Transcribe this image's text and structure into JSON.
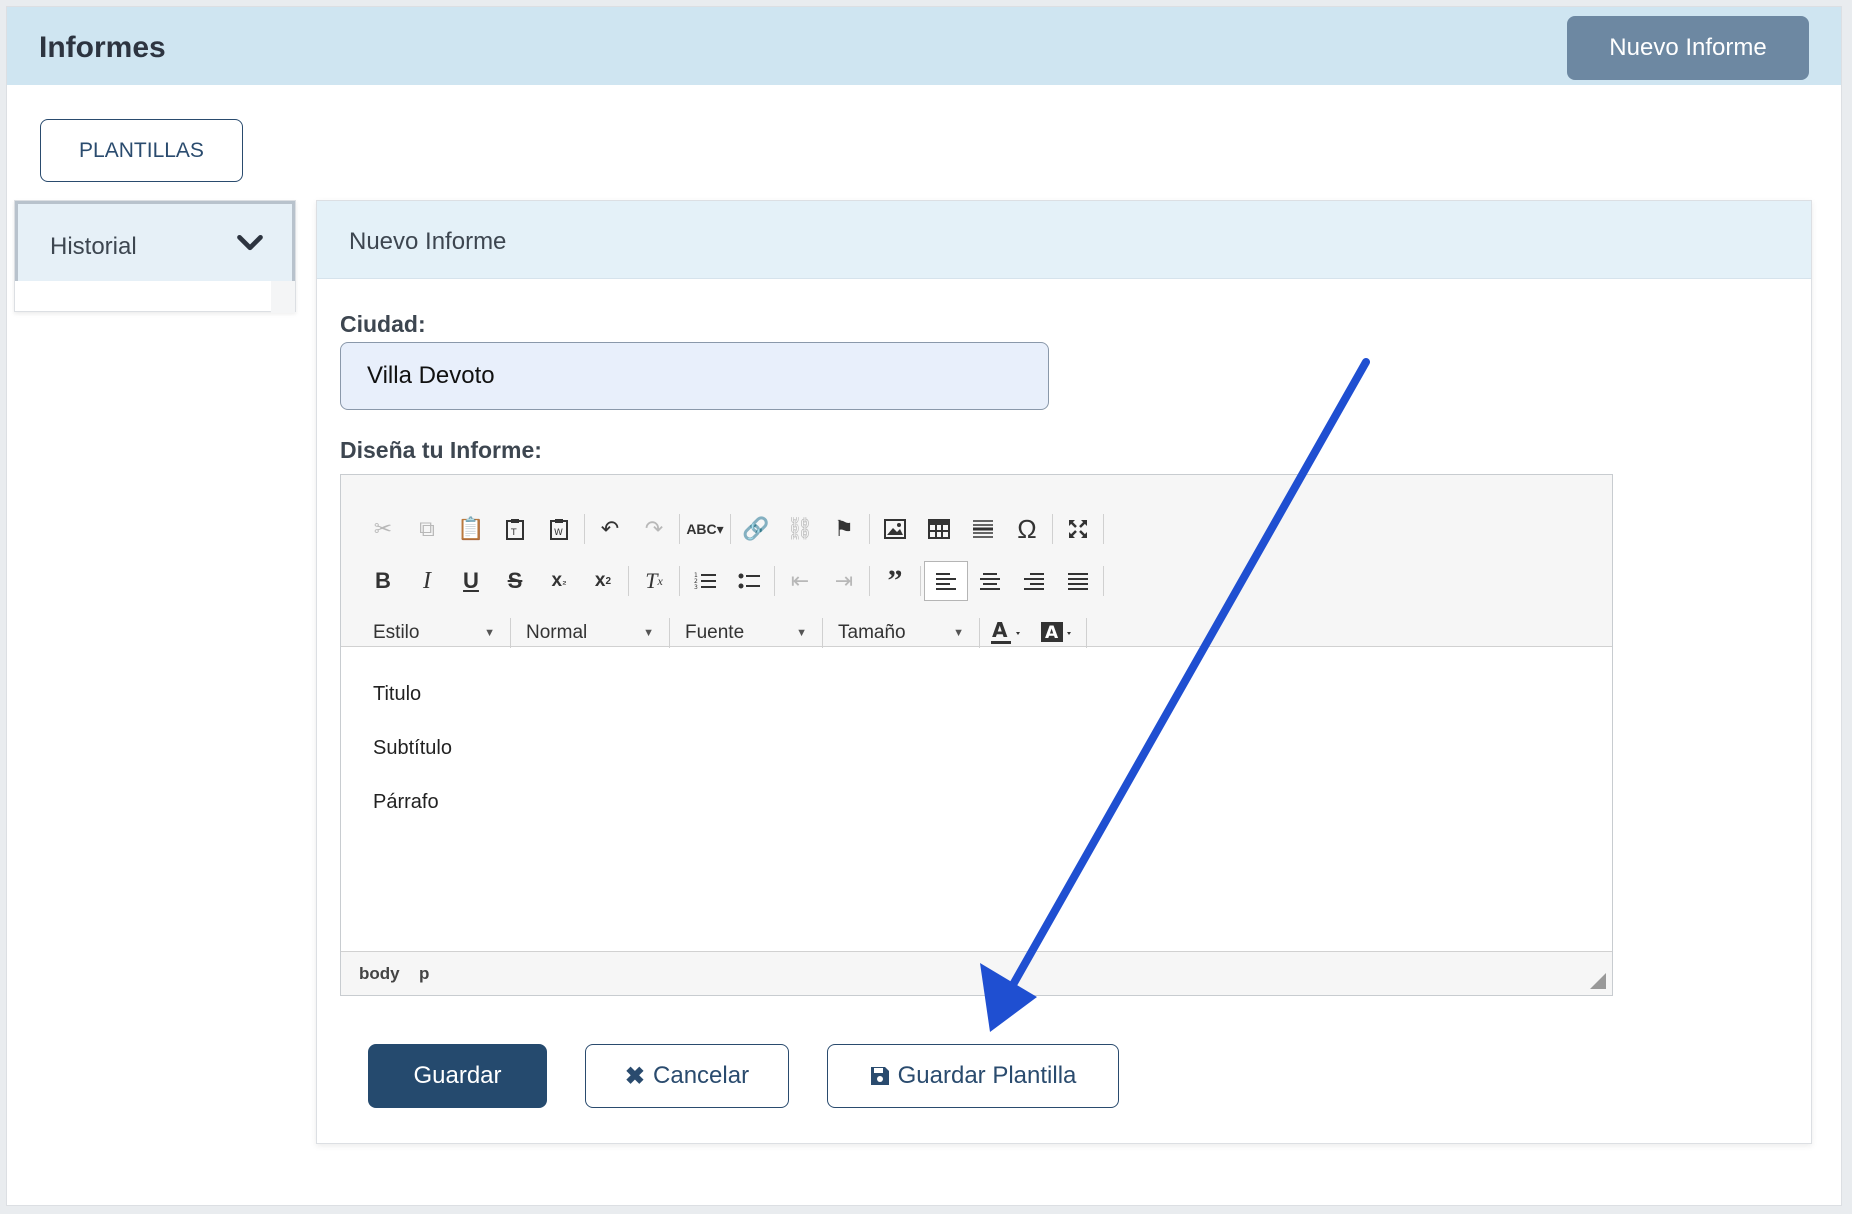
{
  "header": {
    "title": "Informes",
    "new_button": "Nuevo Informe"
  },
  "templates_button": "PLANTILLAS",
  "sidebar": {
    "historial_label": "Historial"
  },
  "panel": {
    "title": "Nuevo Informe"
  },
  "form": {
    "city_label": "Ciudad:",
    "city_value": "Villa Devoto",
    "design_label": "Diseña tu Informe:"
  },
  "editor": {
    "combos": {
      "style": "Estilo",
      "format": "Normal",
      "font": "Fuente",
      "size": "Tamaño"
    },
    "content": [
      "Titulo",
      "Subtítulo",
      "Párrafo"
    ],
    "path": [
      "body",
      "p"
    ]
  },
  "actions": {
    "save": "Guardar",
    "cancel": "Cancelar",
    "save_template": "Guardar Plantilla"
  },
  "colors": {
    "accent": "#254a6e",
    "header_bg": "#cfe5f1",
    "arrow": "#1f4fd1"
  }
}
